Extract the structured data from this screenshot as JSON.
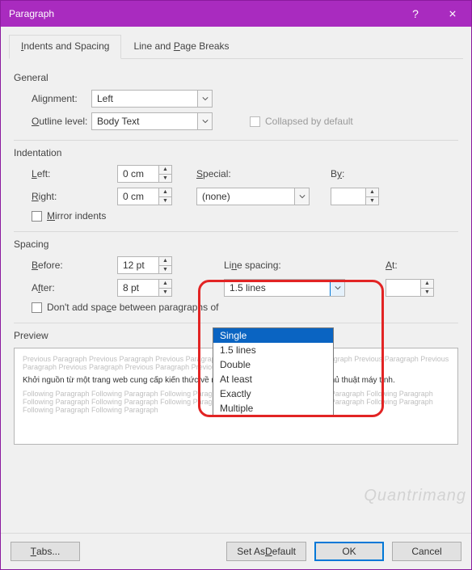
{
  "title": "Paragraph",
  "tabs": {
    "active": "Indents and Spacing",
    "other": "Line and Page Breaks"
  },
  "sections": {
    "general": "General",
    "indentation": "Indentation",
    "spacing": "Spacing",
    "preview": "Preview"
  },
  "general": {
    "alignment_label": "Alignment:",
    "alignment_value": "Left",
    "outline_label": "Outline level:",
    "outline_value": "Body Text",
    "collapsed_label": "Collapsed by default"
  },
  "indent": {
    "left_label": "Left:",
    "left_value": "0 cm",
    "right_label": "Right:",
    "right_value": "0 cm",
    "special_label": "Special:",
    "special_value": "(none)",
    "by_label": "By:",
    "by_value": "",
    "mirror_label": "Mirror indents"
  },
  "spacing": {
    "before_label": "Before:",
    "before_value": "12 pt",
    "after_label": "After:",
    "after_value": "8 pt",
    "line_label": "Line spacing:",
    "line_value": "1.5 lines",
    "at_label": "At:",
    "at_value": "",
    "nospace_label": "Don't add space between paragraphs of",
    "options": [
      "Single",
      "1.5 lines",
      "Double",
      "At least",
      "Exactly",
      "Multiple"
    ],
    "selected_option": "Single"
  },
  "preview": {
    "ghost_prev": "Previous Paragraph Previous Paragraph Previous Paragraph Previous Paragraph Previous Paragraph Previous Paragraph Previous Paragraph Previous Paragraph Previous Paragraph Previous Paragraph",
    "live_text": "Khởi nguồn từ một trang web cung cấp kiến thức về mạng, server, các thiết bị mạng, thủ thuật máy tính.",
    "ghost_next": "Following Paragraph Following Paragraph Following Paragraph Following Paragraph Following Paragraph Following Paragraph Following Paragraph Following Paragraph Following Paragraph Following Paragraph Following Paragraph Following Paragraph Following Paragraph Following Paragraph"
  },
  "buttons": {
    "tabs": "Tabs...",
    "default": "Set As Default",
    "ok": "OK",
    "cancel": "Cancel"
  },
  "watermark": "Quantrimang"
}
